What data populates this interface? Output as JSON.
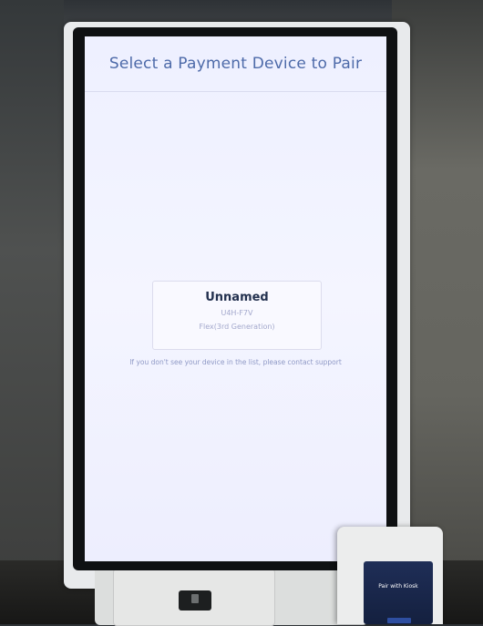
{
  "screen": {
    "header": {
      "title": "Select a Payment Device to Pair"
    },
    "device_list": [
      {
        "name": "Unnamed",
        "id": "U4H-F7V",
        "model": "Flex(3rd Generation)"
      }
    ],
    "support_note": "If you don't see your device in the list, please contact support"
  },
  "terminal": {
    "title": "Pair with Kiosk",
    "subtitle": ""
  },
  "colors": {
    "header_text": "#4d6aa9",
    "device_name": "#23314f",
    "muted_text": "#a3a8cc",
    "screen_bg": "#f0f1ff"
  }
}
